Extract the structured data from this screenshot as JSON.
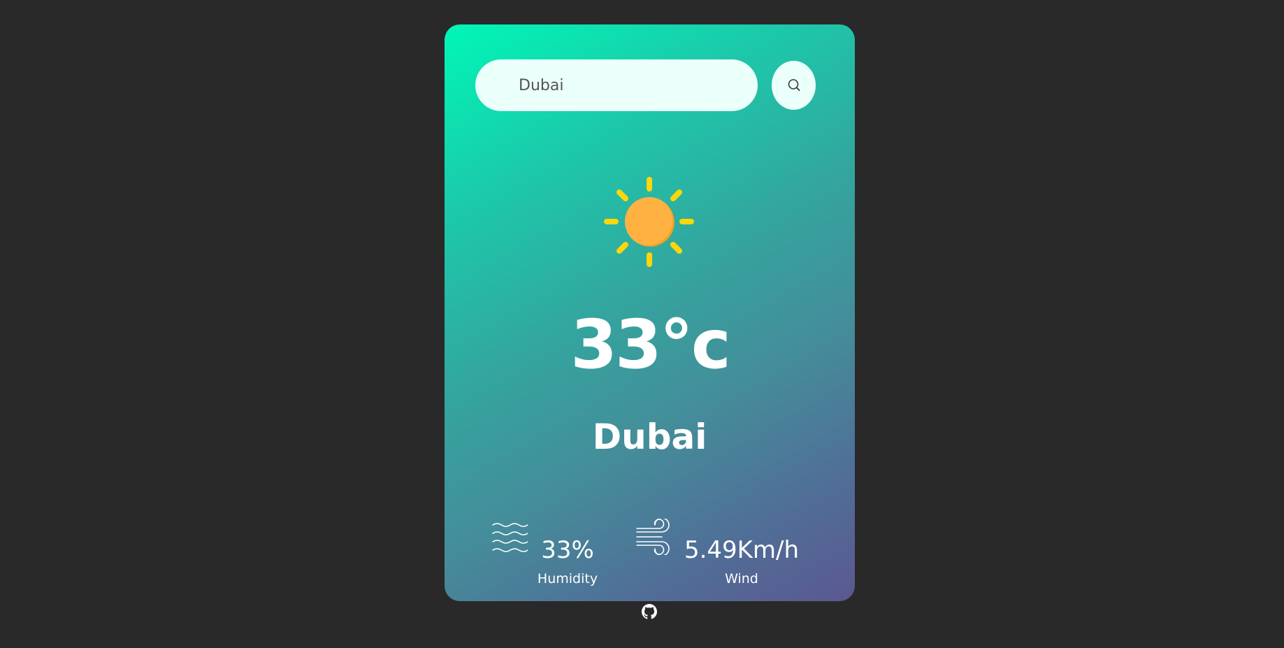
{
  "search": {
    "value": "Dubai",
    "icon": "search-icon"
  },
  "weather": {
    "condition_icon": "sun-icon",
    "temperature": "33°c",
    "city": "Dubai"
  },
  "details": {
    "humidity": {
      "icon": "humidity-waves-icon",
      "value": "33%",
      "label": "Humidity"
    },
    "wind": {
      "icon": "wind-icon",
      "value": "5.49Km/h",
      "label": "Wind"
    }
  },
  "footer": {
    "icon": "github-icon"
  },
  "colors": {
    "background": "#2a2929",
    "card_gradient_start": "#00f7b7",
    "card_gradient_end": "#5b5890",
    "input_background": "#ebfffb",
    "sun_ray": "#ffd60a",
    "sun_core": "#ffb142",
    "text": "#ffffff"
  }
}
